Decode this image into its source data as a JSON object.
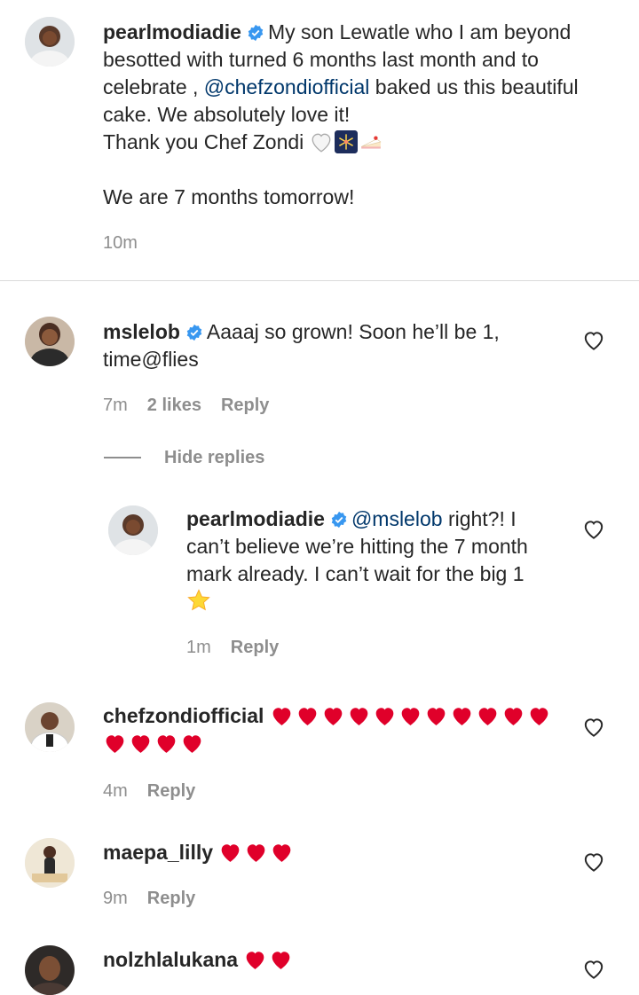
{
  "colors": {
    "link": "#00376b",
    "verified": "#3897f0",
    "muted": "#8e8e8e",
    "heart": "#e0002a"
  },
  "caption": {
    "username": "pearlmodiadie",
    "text1": "My son Lewatle who I am beyond besotted with turned 6 months last month and to celebrate ,",
    "mention": "@chefzondiofficial",
    "text2": "baked us this beautiful cake. We absolutely love it!",
    "text3": "Thank you Chef Zondi",
    "text4": "We are 7 months tomorrow!",
    "time": "10m",
    "emojis": [
      "white-heart-icon",
      "fireworks-icon",
      "cake-slice-icon"
    ]
  },
  "comments": [
    {
      "username": "mslelob",
      "verified": true,
      "text": "Aaaaj so grown! Soon he’ll be 1, time@flies",
      "time": "7m",
      "likes": "2 likes",
      "reply": "Reply",
      "hide_replies": "Hide replies",
      "replies": [
        {
          "username": "pearlmodiadie",
          "verified": true,
          "mention": "@mslelob",
          "text": "right?! I can’t believe we’re hitting the 7 month mark already. I can’t wait for the big 1",
          "emoji": "star-icon",
          "time": "1m",
          "reply": "Reply"
        }
      ]
    },
    {
      "username": "chefzondiofficial",
      "hearts": 15,
      "time": "4m",
      "reply": "Reply"
    },
    {
      "username": "maepa_lilly",
      "hearts": 3,
      "time": "9m",
      "reply": "Reply"
    },
    {
      "username": "nolzhlalukana",
      "hearts": 2
    }
  ]
}
